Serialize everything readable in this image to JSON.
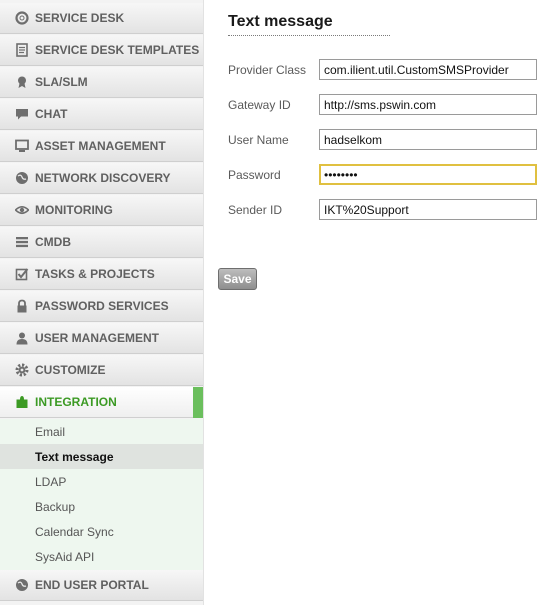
{
  "sidebar": {
    "items": [
      {
        "label": "SERVICE DESK",
        "icon": "lifebuoy-icon"
      },
      {
        "label": "SERVICE DESK TEMPLATES",
        "icon": "template-icon"
      },
      {
        "label": "SLA/SLM",
        "icon": "badge-icon"
      },
      {
        "label": "CHAT",
        "icon": "chat-bubble-icon"
      },
      {
        "label": "ASSET MANAGEMENT",
        "icon": "monitor-icon"
      },
      {
        "label": "NETWORK DISCOVERY",
        "icon": "globe-icon"
      },
      {
        "label": "MONITORING",
        "icon": "eye-icon"
      },
      {
        "label": "CMDB",
        "icon": "list-icon"
      },
      {
        "label": "TASKS & PROJECTS",
        "icon": "checkbox-icon"
      },
      {
        "label": "PASSWORD SERVICES",
        "icon": "lock-icon"
      },
      {
        "label": "USER MANAGEMENT",
        "icon": "user-icon"
      },
      {
        "label": "CUSTOMIZE",
        "icon": "gear-icon"
      },
      {
        "label": "INTEGRATION",
        "icon": "puzzle-icon",
        "active": true
      },
      {
        "label": "END USER PORTAL",
        "icon": "globe-icon"
      }
    ],
    "submenu": [
      {
        "label": "Email"
      },
      {
        "label": "Text message",
        "selected": true
      },
      {
        "label": "LDAP"
      },
      {
        "label": "Backup"
      },
      {
        "label": "Calendar Sync"
      },
      {
        "label": "SysAid API"
      }
    ],
    "accent_color": "#6bbf5d",
    "active_text_color": "#3c9a24"
  },
  "main": {
    "title": "Text message",
    "fields": [
      {
        "label": "Provider Class",
        "value": "com.ilient.util.CustomSMSProvider"
      },
      {
        "label": "Gateway ID",
        "value": "http://sms.pswin.com"
      },
      {
        "label": "User Name",
        "value": "hadselkom"
      },
      {
        "label": "Password",
        "value": "••••••••",
        "focused": true
      },
      {
        "label": "Sender ID",
        "value": "IKT%20Support"
      }
    ],
    "save_label": "Save"
  }
}
